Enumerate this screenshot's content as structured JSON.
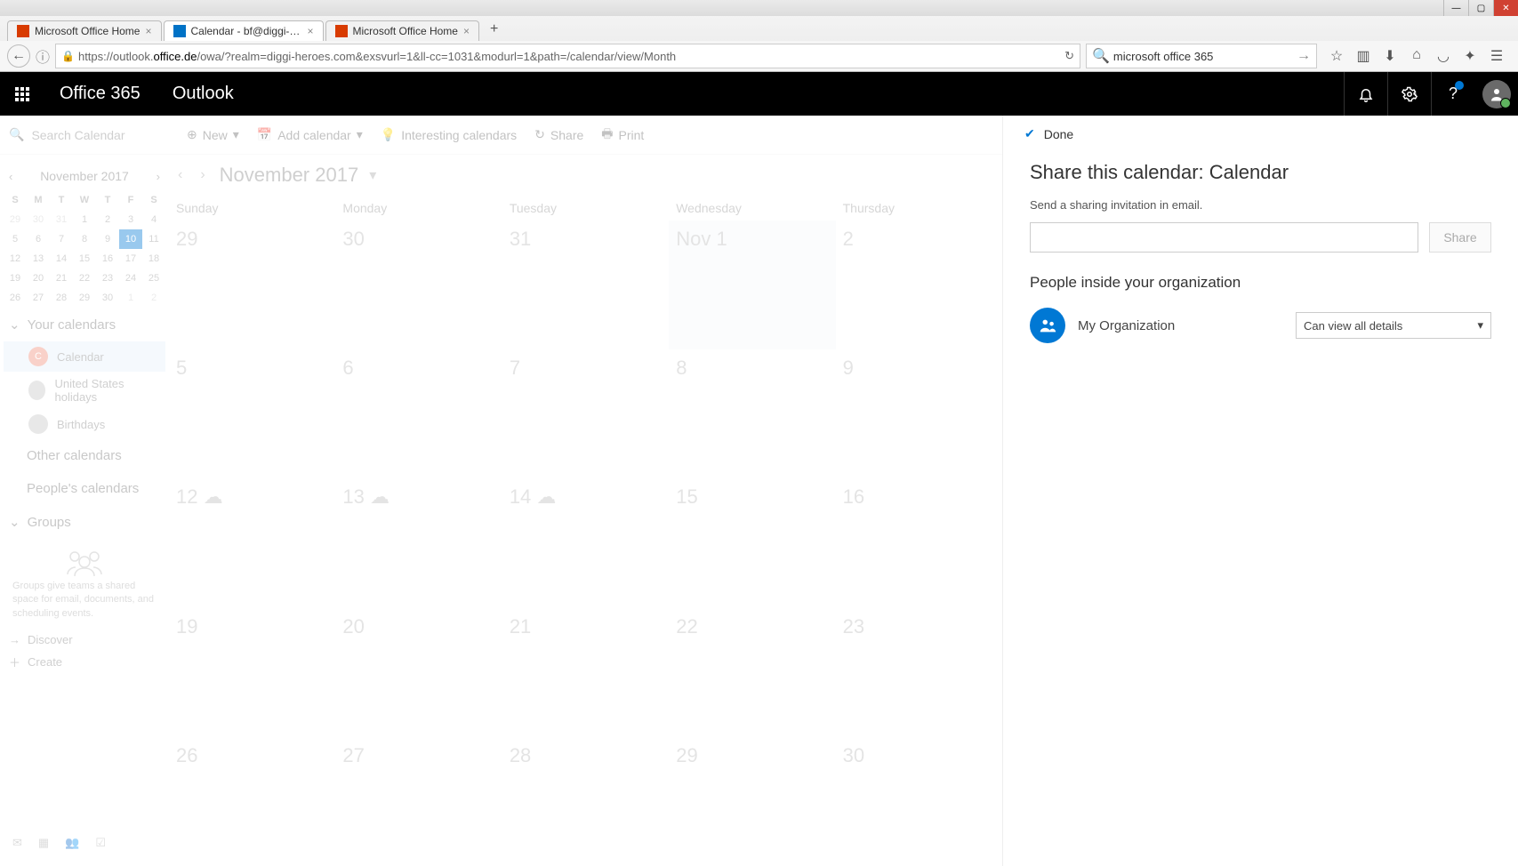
{
  "browser": {
    "tabs": [
      {
        "label": "Microsoft Office Home",
        "favicon": "fav-o365",
        "active": false
      },
      {
        "label": "Calendar - bf@diggi-heroes…",
        "favicon": "fav-outlook",
        "active": true
      },
      {
        "label": "Microsoft Office Home",
        "favicon": "fav-o365",
        "active": false
      }
    ],
    "url_prefix": "https://outlook.",
    "url_domain": "office.de",
    "url_rest": "/owa/?realm=diggi-heroes.com&exsvurl=1&ll-cc=1031&modurl=1&path=/calendar/view/Month",
    "search_text": "microsoft office 365"
  },
  "header": {
    "brand": "Office 365",
    "app": "Outlook"
  },
  "cmdbar": {
    "search_placeholder": "Search Calendar",
    "new": "New",
    "add_calendar": "Add calendar",
    "interesting": "Interesting calendars",
    "share": "Share",
    "print": "Print"
  },
  "mini": {
    "month": "November 2017",
    "dow": [
      "S",
      "M",
      "T",
      "W",
      "T",
      "F",
      "S"
    ],
    "weeks": [
      [
        {
          "n": "29",
          "dim": true
        },
        {
          "n": "30",
          "dim": true
        },
        {
          "n": "31",
          "dim": true
        },
        {
          "n": "1"
        },
        {
          "n": "2"
        },
        {
          "n": "3"
        },
        {
          "n": "4"
        }
      ],
      [
        {
          "n": "5"
        },
        {
          "n": "6"
        },
        {
          "n": "7"
        },
        {
          "n": "8"
        },
        {
          "n": "9"
        },
        {
          "n": "10",
          "today": true
        },
        {
          "n": "11"
        }
      ],
      [
        {
          "n": "12"
        },
        {
          "n": "13"
        },
        {
          "n": "14"
        },
        {
          "n": "15"
        },
        {
          "n": "16"
        },
        {
          "n": "17"
        },
        {
          "n": "18"
        }
      ],
      [
        {
          "n": "19"
        },
        {
          "n": "20"
        },
        {
          "n": "21"
        },
        {
          "n": "22"
        },
        {
          "n": "23"
        },
        {
          "n": "24"
        },
        {
          "n": "25"
        }
      ],
      [
        {
          "n": "26"
        },
        {
          "n": "27"
        },
        {
          "n": "28"
        },
        {
          "n": "29"
        },
        {
          "n": "30"
        },
        {
          "n": "1",
          "dim": true
        },
        {
          "n": "2",
          "dim": true
        }
      ]
    ]
  },
  "sidebar": {
    "your_calendars": "Your calendars",
    "items": [
      {
        "label": "Calendar",
        "color": "#f08c78",
        "initial": "C",
        "active": true
      },
      {
        "label": "United States holidays",
        "color": "#c5c5c5",
        "initial": ""
      },
      {
        "label": "Birthdays",
        "color": "#c5c5c5",
        "initial": ""
      }
    ],
    "other": "Other calendars",
    "peoples": "People's calendars",
    "groups": "Groups",
    "groups_text": "Groups give teams a shared space for email, documents, and scheduling events.",
    "discover": "Discover",
    "create": "Create"
  },
  "calendar": {
    "title": "November 2017",
    "dow": [
      "Sunday",
      "Monday",
      "Tuesday",
      "Wednesday",
      "Thursday"
    ],
    "weeks": [
      [
        "29",
        "30",
        "31",
        "Nov 1",
        "2"
      ],
      [
        "5",
        "6",
        "7",
        "8",
        "9"
      ],
      [
        "12 ☁",
        "13 ☁",
        "14 ☁",
        "15",
        "16"
      ],
      [
        "19",
        "20",
        "21",
        "22",
        "23"
      ],
      [
        "26",
        "27",
        "28",
        "29",
        "30"
      ]
    ]
  },
  "share_panel": {
    "done": "Done",
    "title": "Share this calendar: Calendar",
    "subtitle": "Send a sharing invitation in email.",
    "share_btn": "Share",
    "org_heading": "People inside your organization",
    "org_name": "My Organization",
    "permission": "Can view all details"
  }
}
